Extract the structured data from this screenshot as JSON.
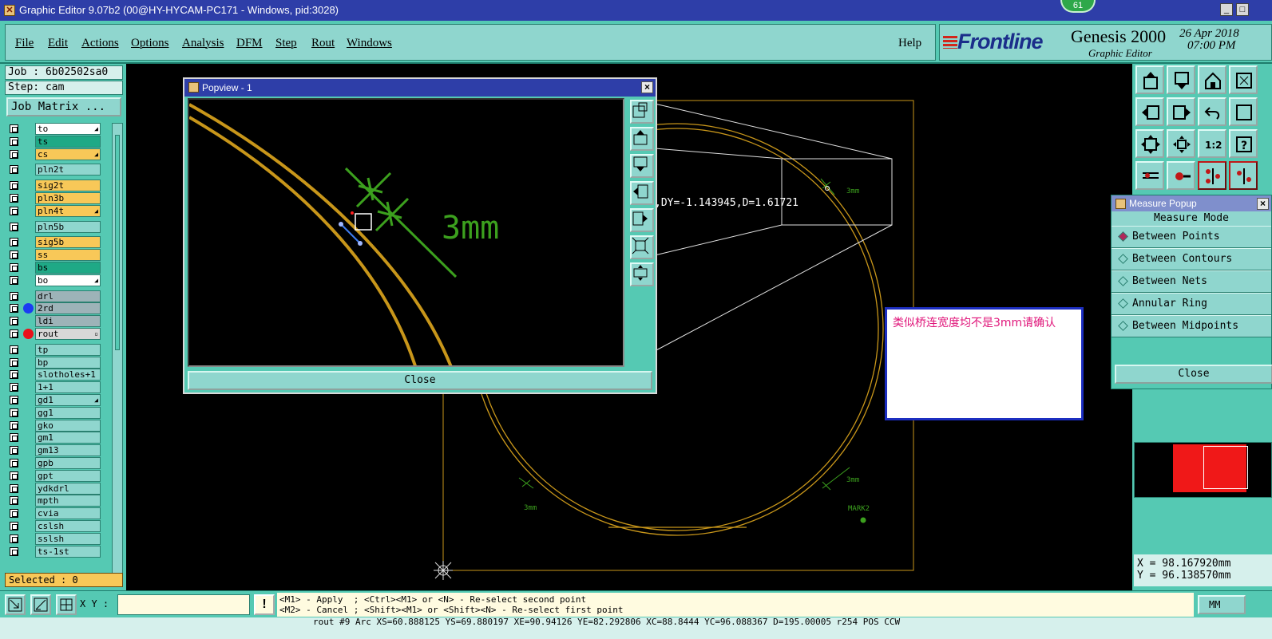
{
  "window": {
    "title": "Graphic Editor 9.07b2 (00@HY-HYCAM-PC171 - Windows, pid:3028)",
    "badge": "61",
    "minimize_label": "_",
    "maximize_label": "□"
  },
  "menu": {
    "items": [
      "File",
      "Edit",
      "Actions",
      "Options",
      "Analysis",
      "DFM",
      "Step",
      "Rout",
      "Windows"
    ],
    "help": "Help"
  },
  "brand": {
    "logo": "Frontline",
    "product": "Genesis 2000",
    "subtitle": "Graphic Editor",
    "date": "26 Apr 2018",
    "time": "07:00 PM"
  },
  "left_panel": {
    "job": "Job : 6b02502sa0",
    "step": "Step: cam",
    "job_matrix": "Job Matrix ...",
    "selected": "Selected : 0",
    "layers": [
      {
        "name": "to",
        "color": "#ffffff",
        "mark": true
      },
      {
        "name": "ts",
        "color": "#1fa986",
        "mark": false
      },
      {
        "name": "cs",
        "color": "#f8c858",
        "mark": true
      },
      {
        "name": "pln2t",
        "color": "#8fd6ce",
        "mark": false,
        "gap": true
      },
      {
        "name": "sig2t",
        "color": "#f8c858",
        "mark": false,
        "gap": true
      },
      {
        "name": "pln3b",
        "color": "#f8c858",
        "mark": false
      },
      {
        "name": "pln4t",
        "color": "#f8c858",
        "mark": true
      },
      {
        "name": "pln5b",
        "color": "#8fd6ce",
        "mark": false,
        "gap": true
      },
      {
        "name": "sig5b",
        "color": "#f8c858",
        "mark": false,
        "gap": true
      },
      {
        "name": "ss",
        "color": "#f8c858",
        "mark": false
      },
      {
        "name": "bs",
        "color": "#1fa986",
        "mark": false
      },
      {
        "name": "bo",
        "color": "#ffffff",
        "mark": true
      },
      {
        "name": "drl",
        "color": "#9db3b8",
        "mark": false,
        "gap": true
      },
      {
        "name": "2rd",
        "color": "#9db3b8",
        "mark": false,
        "dot": "#1b3cf2"
      },
      {
        "name": "ldi",
        "color": "#9db3b8",
        "mark": false
      },
      {
        "name": "rout",
        "color": "#d8d8d8",
        "mark": false,
        "dot": "#e8101a",
        "box": true
      },
      {
        "name": "tp",
        "color": "#8fd6ce",
        "mark": false,
        "gap": true
      },
      {
        "name": "bp",
        "color": "#8fd6ce",
        "mark": false
      },
      {
        "name": "slotholes+1",
        "color": "#8fd6ce",
        "mark": false
      },
      {
        "name": "1+1",
        "color": "#8fd6ce",
        "mark": false
      },
      {
        "name": "gd1",
        "color": "#8fd6ce",
        "mark": true
      },
      {
        "name": "gg1",
        "color": "#8fd6ce",
        "mark": false
      },
      {
        "name": "gko",
        "color": "#8fd6ce",
        "mark": false
      },
      {
        "name": "gm1",
        "color": "#8fd6ce",
        "mark": false
      },
      {
        "name": "gm13",
        "color": "#8fd6ce",
        "mark": false
      },
      {
        "name": "gpb",
        "color": "#8fd6ce",
        "mark": false
      },
      {
        "name": "gpt",
        "color": "#8fd6ce",
        "mark": false
      },
      {
        "name": "ydkdrl",
        "color": "#8fd6ce",
        "mark": false
      },
      {
        "name": "mpth",
        "color": "#8fd6ce",
        "mark": false
      },
      {
        "name": "cvia",
        "color": "#8fd6ce",
        "mark": false
      },
      {
        "name": "cslsh",
        "color": "#8fd6ce",
        "mark": false
      },
      {
        "name": "sslsh",
        "color": "#8fd6ce",
        "mark": false
      },
      {
        "name": "ts-1st",
        "color": "#8fd6ce",
        "mark": false
      }
    ]
  },
  "popview": {
    "title": "Popview - 1",
    "dimension_label": "3mm",
    "close_label": "Close"
  },
  "canvas": {
    "measure_readout": ",DY=-1.143945,D=1.61721",
    "dim_top": "3mm",
    "dim_left": "3mm",
    "dim_right": "3mm",
    "mark_label": "MARK2"
  },
  "note": {
    "text": "类似桥连宽度均不是3mm请确认"
  },
  "measure_popup": {
    "title": "Measure Popup",
    "mode_label": "Measure Mode",
    "options": [
      {
        "label": "Between Points",
        "selected": true
      },
      {
        "label": "Between Contours",
        "selected": false
      },
      {
        "label": "Between Nets",
        "selected": false
      },
      {
        "label": "Annular Ring",
        "selected": false
      },
      {
        "label": "Between Midpoints",
        "selected": false
      }
    ],
    "close_label": "Close"
  },
  "coordinates": {
    "x": "X = 98.167920mm",
    "y": "Y = 96.138570mm"
  },
  "bottom": {
    "xy_label": "X Y :",
    "xy_value": "",
    "warn": "!",
    "prompt_line1": "<M1> - Apply  ; <Ctrl><M1> or <N> - Re-select second point",
    "prompt_line2": "<M2> - Cancel ; <Shift><M1> or <Shift><N> - Re-select first point",
    "units": "MM",
    "status": "rout #9 Arc XS=60.888125 YS=69.880197 XE=90.94126 YE=82.292806 XC=88.8444 YC=96.088367 D=195.00005 r254 POS CCW"
  }
}
